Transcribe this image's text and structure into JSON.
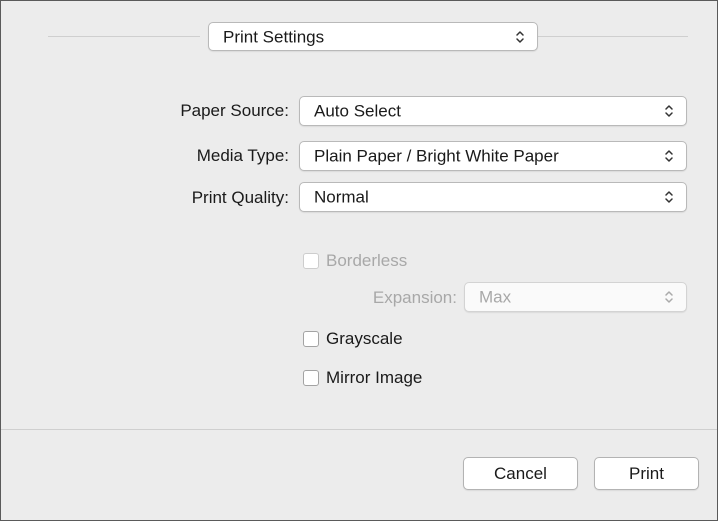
{
  "header": {
    "panel_select": {
      "value": "Print Settings"
    }
  },
  "settings": {
    "paper_source": {
      "label": "Paper Source:",
      "value": "Auto Select"
    },
    "media_type": {
      "label": "Media Type:",
      "value": "Plain Paper / Bright White Paper"
    },
    "print_quality": {
      "label": "Print Quality:",
      "value": "Normal"
    }
  },
  "options": {
    "borderless": {
      "label": "Borderless",
      "checked": false,
      "enabled": false
    },
    "expansion": {
      "label": "Expansion:",
      "value": "Max",
      "enabled": false
    },
    "grayscale": {
      "label": "Grayscale",
      "checked": false
    },
    "mirror_image": {
      "label": "Mirror Image",
      "checked": false
    }
  },
  "footer": {
    "cancel_label": "Cancel",
    "print_label": "Print"
  },
  "icons": {
    "popup_arrows": "up-down-chevron-icon"
  }
}
